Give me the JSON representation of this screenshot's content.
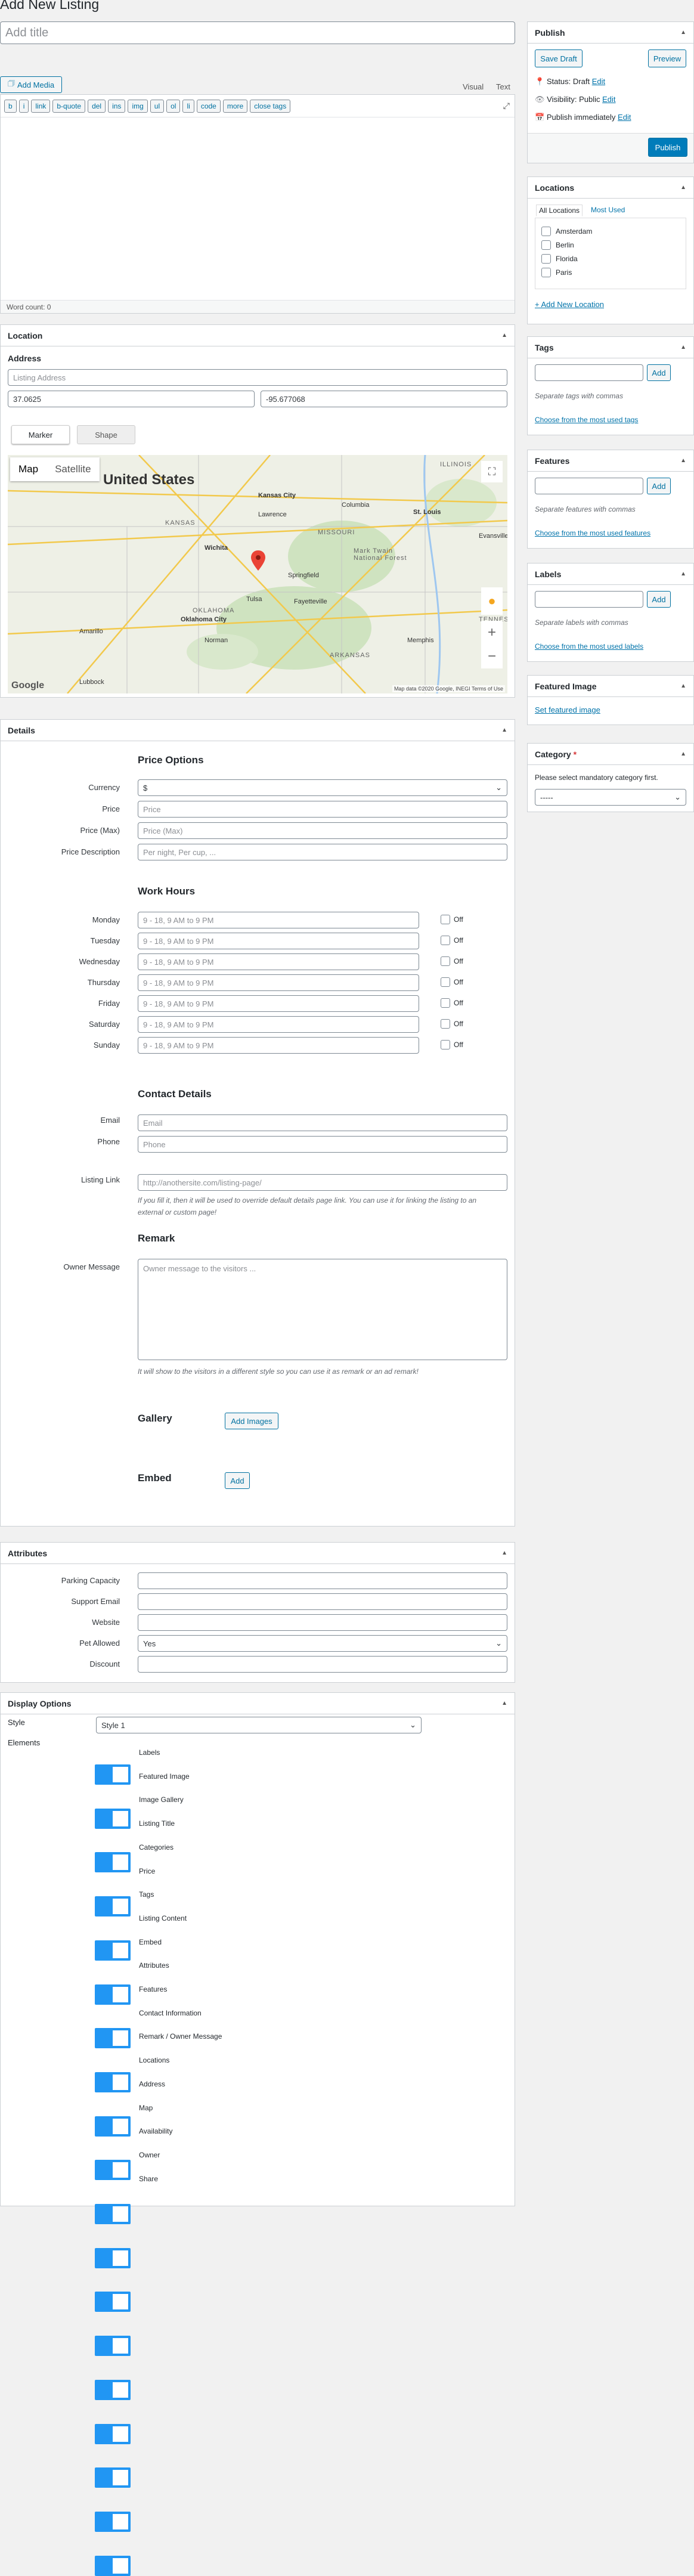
{
  "page": {
    "title": "Add New Listing",
    "title_placeholder": "Add title"
  },
  "editor": {
    "add_media": "Add Media",
    "tab_visual": "Visual",
    "tab_text": "Text",
    "quicktags": [
      "b",
      "i",
      "link",
      "b-quote",
      "del",
      "ins",
      "img",
      "ul",
      "ol",
      "li",
      "code",
      "more",
      "close tags"
    ],
    "word_count": "Word count: 0"
  },
  "location": {
    "header": "Location",
    "address_label": "Address",
    "address_placeholder": "Listing Address",
    "lat": "37.0625",
    "lng": "-95.677068",
    "tab_marker": "Marker",
    "tab_shape": "Shape",
    "map_btn": "Map",
    "satellite_btn": "Satellite",
    "map_title": "United States",
    "places": [
      "Kansas City",
      "St. Louis",
      "Wichita",
      "Oklahoma City",
      "Tulsa",
      "Springfield",
      "Columbia",
      "Memphis",
      "Amarillo",
      "Lubbock",
      "Norman",
      "Fayetteville",
      "Evansville",
      "Lawrence"
    ],
    "regions": [
      "KANSAS",
      "MISSOURI",
      "OKLAHOMA",
      "ARKANSAS",
      "ILLINOIS",
      "TENNESSEE",
      "Mark Twain National Forest"
    ],
    "google": "Google",
    "attribution": "Map data ©2020 Google, INEGI   Terms of Use"
  },
  "details": {
    "header": "Details",
    "price_title": "Price Options",
    "currency_label": "Currency",
    "currency_value": "$",
    "price_label": "Price",
    "price_placeholder": "Price",
    "price_max_label": "Price (Max)",
    "price_max_placeholder": "Price (Max)",
    "price_desc_label": "Price Description",
    "price_desc_placeholder": "Per night, Per cup, ...",
    "work_title": "Work Hours",
    "days": [
      "Monday",
      "Tuesday",
      "Wednesday",
      "Thursday",
      "Friday",
      "Saturday",
      "Sunday"
    ],
    "hours_placeholder": "9 - 18, 9 AM to 9 PM",
    "off_label": "Off",
    "contact_title": "Contact Details",
    "email_label": "Email",
    "email_placeholder": "Email",
    "phone_label": "Phone",
    "phone_placeholder": "Phone",
    "link_label": "Listing Link",
    "link_placeholder": "http://anothersite.com/listing-page/",
    "link_hint": "If you fill it, then it will be used to override default details page link. You can use it for linking the listing to an external or custom page!",
    "remark_title": "Remark",
    "owner_label": "Owner Message",
    "owner_placeholder": "Owner message to the visitors ...",
    "owner_hint": "It will show to the visitors in a different style so you can use it as remark or an ad remark!",
    "gallery_title": "Gallery",
    "add_images": "Add Images",
    "embed_title": "Embed",
    "add_embed": "Add"
  },
  "attributes": {
    "header": "Attributes",
    "fields": [
      "Parking Capacity",
      "Support Email",
      "Website",
      "Pet Allowed",
      "Discount"
    ],
    "pet_value": "Yes"
  },
  "display": {
    "header": "Display Options",
    "style_label": "Style",
    "style_value": "Style 1",
    "elements_label": "Elements",
    "elements": [
      "Labels",
      "Featured Image",
      "Image Gallery",
      "Listing Title",
      "Categories",
      "Price",
      "Tags",
      "Listing Content",
      "Embed",
      "Attributes",
      "Features",
      "Contact Information",
      "Remark / Owner Message",
      "Locations",
      "Address",
      "Map",
      "Availability",
      "Owner",
      "Share"
    ]
  },
  "publish": {
    "header": "Publish",
    "save_draft": "Save Draft",
    "preview": "Preview",
    "status": "Status: Draft",
    "visibility": "Visibility: Public",
    "publish_time": "Publish immediately",
    "edit": "Edit",
    "publish_btn": "Publish"
  },
  "locations_box": {
    "header": "Locations",
    "tab_all": "All Locations",
    "tab_used": "Most Used",
    "items": [
      "Amsterdam",
      "Berlin",
      "Florida",
      "Paris"
    ],
    "add_new": "+ Add New Location"
  },
  "tags_box": {
    "header": "Tags",
    "add": "Add",
    "hint": "Separate tags with commas",
    "choose": "Choose from the most used tags"
  },
  "features_box": {
    "header": "Features",
    "add": "Add",
    "hint": "Separate features with commas",
    "choose": "Choose from the most used features"
  },
  "labels_box": {
    "header": "Labels",
    "add": "Add",
    "hint": "Separate labels with commas",
    "choose": "Choose from the most used labels"
  },
  "featured_box": {
    "header": "Featured Image",
    "link": "Set featured image"
  },
  "category_box": {
    "header": "Category",
    "required": "*",
    "hint": "Please select mandatory category first.",
    "select_value": "-----"
  }
}
